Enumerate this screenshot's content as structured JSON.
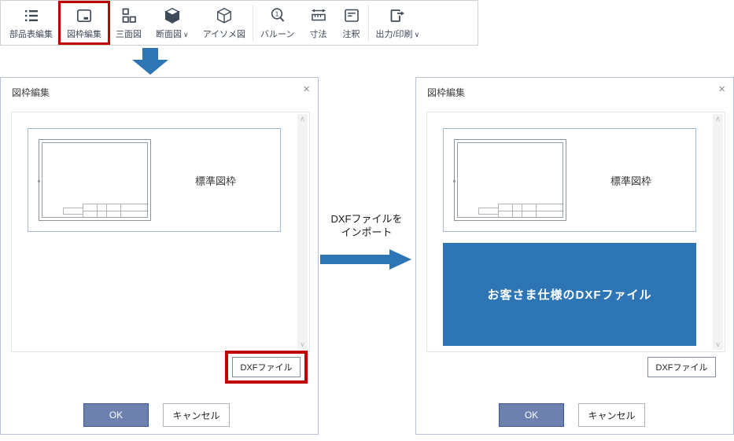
{
  "toolbar": {
    "items": [
      {
        "label": "部品表編集",
        "icon": "list-icon"
      },
      {
        "label": "図枠編集",
        "icon": "frame-icon",
        "highlighted": true
      },
      {
        "label": "三面図",
        "icon": "three-view-icon"
      },
      {
        "label": "断面図",
        "icon": "section-cube-icon",
        "chevron": "∨"
      },
      {
        "label": "アイソメ図",
        "icon": "iso-cube-icon"
      },
      {
        "label": "バルーン",
        "icon": "balloon-icon",
        "badge_number": "1"
      },
      {
        "label": "寸法",
        "icon": "dimension-icon"
      },
      {
        "label": "注釈",
        "icon": "annotation-icon"
      },
      {
        "label": "出力/印刷",
        "icon": "export-icon",
        "chevron": "∨"
      }
    ]
  },
  "flow": {
    "import_caption_line1": "DXFファイルを",
    "import_caption_line2": "インポート"
  },
  "dialogs": {
    "left": {
      "title": "図枠編集",
      "frame_item_label": "標準図枠",
      "dxf_button_label": "DXFファイル",
      "ok_label": "OK",
      "cancel_label": "キャンセル",
      "dxf_button_highlighted": true
    },
    "right": {
      "title": "図枠編集",
      "frame_item_label": "標準図枠",
      "banner_label": "お客さま仕様のDXFファイル",
      "dxf_button_label": "DXFファイル",
      "ok_label": "OK",
      "cancel_label": "キャンセル"
    }
  },
  "ui": {
    "close_glyph": "×",
    "scroll_up_glyph": "∧",
    "scroll_down_glyph": "∨"
  },
  "colors": {
    "accent_blue": "#2e75b6",
    "highlight_red": "#c00000",
    "ok_button_fill": "#6d81ae",
    "ok_button_border": "#3b5492",
    "dialog_border": "#b6c1d8",
    "item_border": "#a3b9dc",
    "toolbar_icon": "#3f4a59"
  }
}
